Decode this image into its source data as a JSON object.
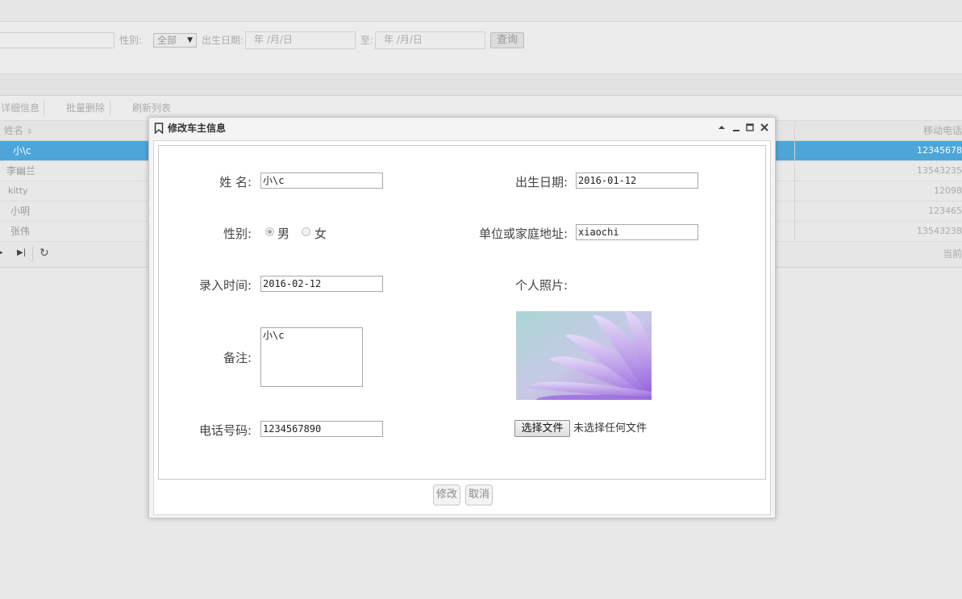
{
  "search": {
    "gender_label": "性别:",
    "gender_value": "全部",
    "birth_label": "出生日期:",
    "date_from_placeholder": "年 /月/日",
    "to_label": "至:",
    "date_to_placeholder": "年 /月/日",
    "query_button": "查询"
  },
  "toolbar": {
    "items": [
      "详细信息",
      "批量删除",
      "刷新列表"
    ]
  },
  "grid": {
    "col_name": "姓名",
    "col_phone": "移动电话",
    "rows": [
      {
        "name": "小\\c",
        "phone": "12345678"
      },
      {
        "name": "李幽兰",
        "phone": "13543235"
      },
      {
        "name": "kitty",
        "phone": "12098"
      },
      {
        "name": "小明",
        "phone": "123465"
      },
      {
        "name": "张伟",
        "phone": "13543238"
      }
    ],
    "pager_right": "当前"
  },
  "dialog": {
    "title": "修改车主信息",
    "name_label": "姓 名:",
    "name_value": "小\\c",
    "birth_label": "出生日期:",
    "birth_value": "2016-01-12",
    "gender_label": "性别:",
    "gender_male": "男",
    "gender_female": "女",
    "gender_selected": "男",
    "address_label": "单位或家庭地址:",
    "address_value": "xiaochi",
    "entry_label": "录入时间:",
    "entry_value": "2016-02-12",
    "photo_label": "个人照片:",
    "remark_label": "备注:",
    "remark_value": "小\\c",
    "phone_label": "电话号码:",
    "phone_value": "1234567890",
    "file_button": "选择文件",
    "file_status": "未选择任何文件",
    "modify_button": "修改",
    "cancel_button": "取消"
  },
  "colors": {
    "selected_row": "#4ea6d8",
    "dialog_title": "#333333"
  }
}
